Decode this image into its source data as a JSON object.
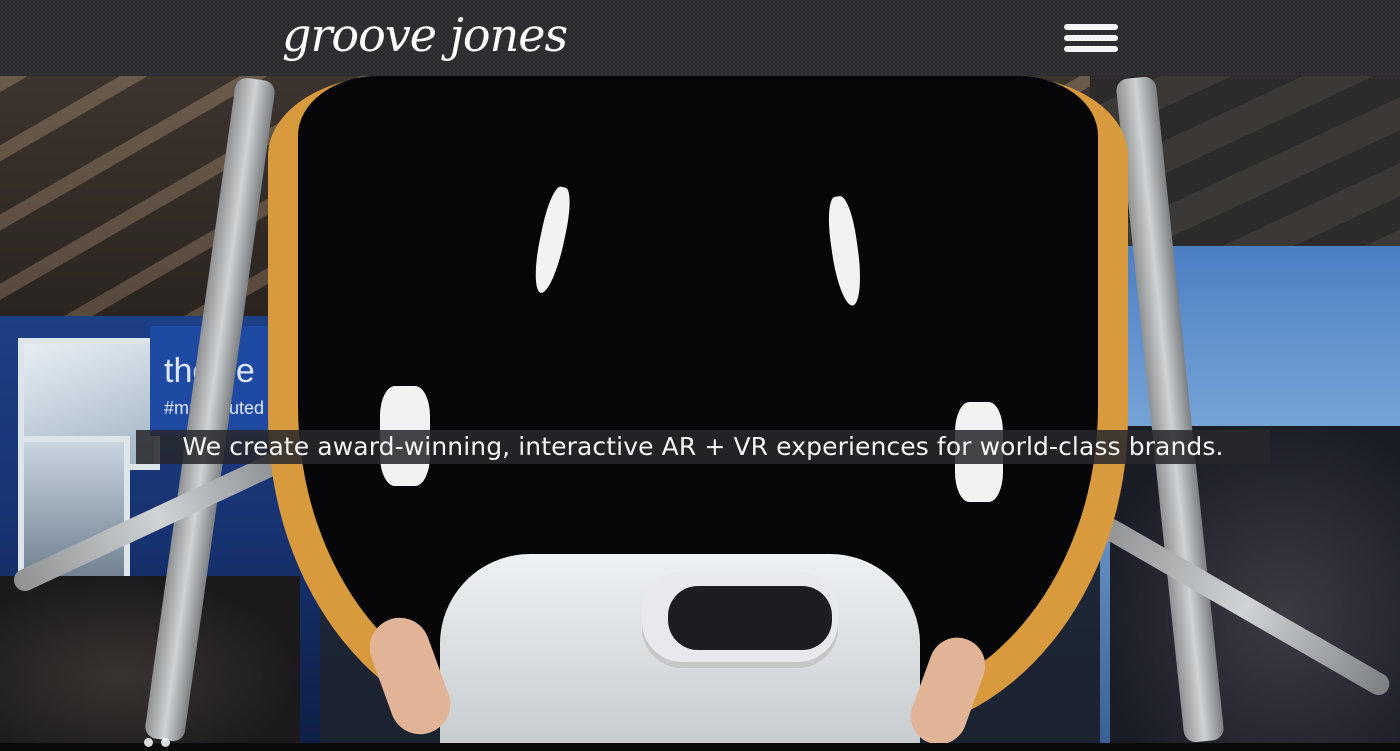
{
  "header": {
    "logo_text": "groove jones",
    "menu_icon": "hamburger-menu-icon"
  },
  "hero": {
    "tagline": "We create award-winning, interactive AR + VR experiences for world-class brands.",
    "banner_text": "thevie",
    "banner_tag": "#mr minuted"
  },
  "colors": {
    "header_bg": "#2c2c31",
    "seat_orange": "#d89a3c",
    "caption_bg": "#28282c",
    "text": "#f4f4f4"
  }
}
